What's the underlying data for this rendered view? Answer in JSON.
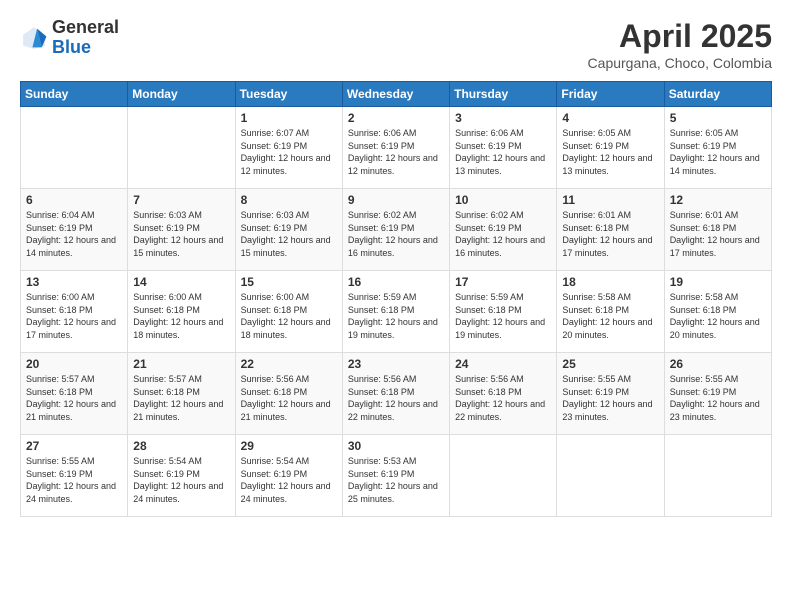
{
  "logo": {
    "general": "General",
    "blue": "Blue"
  },
  "header": {
    "month_year": "April 2025",
    "location": "Capurgana, Choco, Colombia"
  },
  "days_of_week": [
    "Sunday",
    "Monday",
    "Tuesday",
    "Wednesday",
    "Thursday",
    "Friday",
    "Saturday"
  ],
  "weeks": [
    [
      {
        "day": "",
        "info": ""
      },
      {
        "day": "",
        "info": ""
      },
      {
        "day": "1",
        "info": "Sunrise: 6:07 AM\nSunset: 6:19 PM\nDaylight: 12 hours and 12 minutes."
      },
      {
        "day": "2",
        "info": "Sunrise: 6:06 AM\nSunset: 6:19 PM\nDaylight: 12 hours and 12 minutes."
      },
      {
        "day": "3",
        "info": "Sunrise: 6:06 AM\nSunset: 6:19 PM\nDaylight: 12 hours and 13 minutes."
      },
      {
        "day": "4",
        "info": "Sunrise: 6:05 AM\nSunset: 6:19 PM\nDaylight: 12 hours and 13 minutes."
      },
      {
        "day": "5",
        "info": "Sunrise: 6:05 AM\nSunset: 6:19 PM\nDaylight: 12 hours and 14 minutes."
      }
    ],
    [
      {
        "day": "6",
        "info": "Sunrise: 6:04 AM\nSunset: 6:19 PM\nDaylight: 12 hours and 14 minutes."
      },
      {
        "day": "7",
        "info": "Sunrise: 6:03 AM\nSunset: 6:19 PM\nDaylight: 12 hours and 15 minutes."
      },
      {
        "day": "8",
        "info": "Sunrise: 6:03 AM\nSunset: 6:19 PM\nDaylight: 12 hours and 15 minutes."
      },
      {
        "day": "9",
        "info": "Sunrise: 6:02 AM\nSunset: 6:19 PM\nDaylight: 12 hours and 16 minutes."
      },
      {
        "day": "10",
        "info": "Sunrise: 6:02 AM\nSunset: 6:19 PM\nDaylight: 12 hours and 16 minutes."
      },
      {
        "day": "11",
        "info": "Sunrise: 6:01 AM\nSunset: 6:18 PM\nDaylight: 12 hours and 17 minutes."
      },
      {
        "day": "12",
        "info": "Sunrise: 6:01 AM\nSunset: 6:18 PM\nDaylight: 12 hours and 17 minutes."
      }
    ],
    [
      {
        "day": "13",
        "info": "Sunrise: 6:00 AM\nSunset: 6:18 PM\nDaylight: 12 hours and 17 minutes."
      },
      {
        "day": "14",
        "info": "Sunrise: 6:00 AM\nSunset: 6:18 PM\nDaylight: 12 hours and 18 minutes."
      },
      {
        "day": "15",
        "info": "Sunrise: 6:00 AM\nSunset: 6:18 PM\nDaylight: 12 hours and 18 minutes."
      },
      {
        "day": "16",
        "info": "Sunrise: 5:59 AM\nSunset: 6:18 PM\nDaylight: 12 hours and 19 minutes."
      },
      {
        "day": "17",
        "info": "Sunrise: 5:59 AM\nSunset: 6:18 PM\nDaylight: 12 hours and 19 minutes."
      },
      {
        "day": "18",
        "info": "Sunrise: 5:58 AM\nSunset: 6:18 PM\nDaylight: 12 hours and 20 minutes."
      },
      {
        "day": "19",
        "info": "Sunrise: 5:58 AM\nSunset: 6:18 PM\nDaylight: 12 hours and 20 minutes."
      }
    ],
    [
      {
        "day": "20",
        "info": "Sunrise: 5:57 AM\nSunset: 6:18 PM\nDaylight: 12 hours and 21 minutes."
      },
      {
        "day": "21",
        "info": "Sunrise: 5:57 AM\nSunset: 6:18 PM\nDaylight: 12 hours and 21 minutes."
      },
      {
        "day": "22",
        "info": "Sunrise: 5:56 AM\nSunset: 6:18 PM\nDaylight: 12 hours and 21 minutes."
      },
      {
        "day": "23",
        "info": "Sunrise: 5:56 AM\nSunset: 6:18 PM\nDaylight: 12 hours and 22 minutes."
      },
      {
        "day": "24",
        "info": "Sunrise: 5:56 AM\nSunset: 6:18 PM\nDaylight: 12 hours and 22 minutes."
      },
      {
        "day": "25",
        "info": "Sunrise: 5:55 AM\nSunset: 6:19 PM\nDaylight: 12 hours and 23 minutes."
      },
      {
        "day": "26",
        "info": "Sunrise: 5:55 AM\nSunset: 6:19 PM\nDaylight: 12 hours and 23 minutes."
      }
    ],
    [
      {
        "day": "27",
        "info": "Sunrise: 5:55 AM\nSunset: 6:19 PM\nDaylight: 12 hours and 24 minutes."
      },
      {
        "day": "28",
        "info": "Sunrise: 5:54 AM\nSunset: 6:19 PM\nDaylight: 12 hours and 24 minutes."
      },
      {
        "day": "29",
        "info": "Sunrise: 5:54 AM\nSunset: 6:19 PM\nDaylight: 12 hours and 24 minutes."
      },
      {
        "day": "30",
        "info": "Sunrise: 5:53 AM\nSunset: 6:19 PM\nDaylight: 12 hours and 25 minutes."
      },
      {
        "day": "",
        "info": ""
      },
      {
        "day": "",
        "info": ""
      },
      {
        "day": "",
        "info": ""
      }
    ]
  ]
}
